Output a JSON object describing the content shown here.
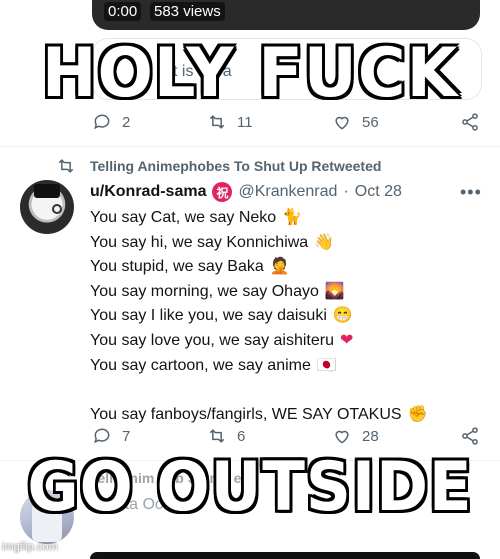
{
  "video": {
    "time": "0:00",
    "views": "583 views"
  },
  "quote_card": {
    "partial_text": "t is Java"
  },
  "meme": {
    "top_text": "HOLY FUCK",
    "bottom_text": "GO OUTSIDE"
  },
  "tweet1_actions": {
    "replies": "2",
    "retweets": "11",
    "likes": "56"
  },
  "retweet_banner": {
    "label": "Telling Animephobes To Shut Up Retweeted"
  },
  "tweet2": {
    "display_name": "u/Konrad-sama",
    "badge": "祝",
    "handle": "@Krankenrad",
    "dot": "·",
    "date": "Oct 28",
    "more": "•••",
    "lines": [
      {
        "text": "You say Cat, we say Neko",
        "emoji": "🐈"
      },
      {
        "text": "You say hi, we say Konnichiwa",
        "emoji": "👋"
      },
      {
        "text": "You stupid, we say Baka",
        "emoji": "🤦"
      },
      {
        "text": "You say morning, we say Ohayo",
        "emoji": "🌄"
      },
      {
        "text": "You say I like you, we say daisuki",
        "emoji": "😁"
      },
      {
        "text": "You say love you, we say aishiteru",
        "emoji": "❤"
      },
      {
        "text": "You say cartoon, we say anime",
        "emoji": "🇯🇵"
      },
      {
        "text": "You say fanboys/fangirls, WE SAY OTAKUS",
        "emoji": "✊"
      }
    ],
    "replies": "7",
    "retweets": "6",
    "likes": "28"
  },
  "tweet3": {
    "partial_header": "Tellin    nim    hob    S    t    me    eed",
    "partial_sub": "Oge    ta    Oct"
  },
  "watermark": "imgflip.com",
  "colors": {
    "meta_gray": "#536471",
    "love_red": "#e0245e",
    "text": "#0f1419"
  }
}
